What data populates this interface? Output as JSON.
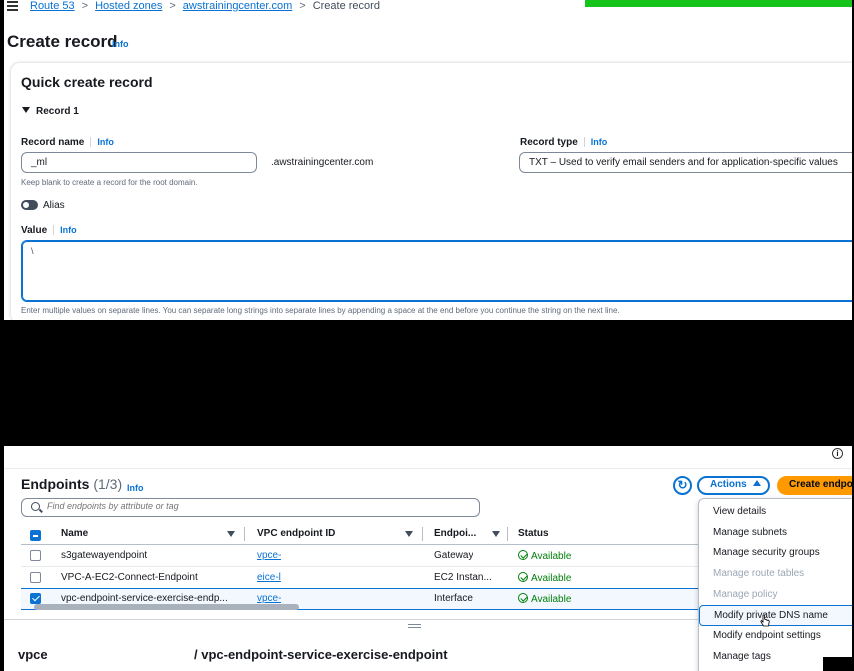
{
  "route53": {
    "breadcrumbs": [
      "Route 53",
      "Hosted zones",
      "awstrainingcenter.com"
    ],
    "breadcrumb_current": "Create record",
    "page_title": "Create record",
    "title_info": "Info",
    "card_title": "Quick create record",
    "record_section": "Record 1",
    "record_name_label": "Record name",
    "record_name_info": "Info",
    "record_name_value": "_ml",
    "domain_suffix": ".awstrainingcenter.com",
    "record_name_hint": "Keep blank to create a record for the root domain.",
    "record_type_label": "Record type",
    "record_type_info": "Info",
    "record_type_value": "TXT – Used to verify email senders and for application-specific values",
    "alias_label": "Alias",
    "value_label": "Value",
    "value_info": "Info",
    "value_text": "\\",
    "value_hint": "Enter multiple values on separate lines. You can separate long strings into separate lines by appending a space at the end before you continue the string on the next line."
  },
  "vpc": {
    "info_icon": "i",
    "title": "Endpoints",
    "count": "(1/3)",
    "title_info": "Info",
    "refresh_icon": "refresh-icon",
    "actions_label": "Actions",
    "create_label": "Create endpoint",
    "search_placeholder": "Find endpoints by attribute or tag",
    "columns": [
      "Name",
      "VPC endpoint ID",
      "Endpoi...",
      "Status"
    ],
    "rows": [
      {
        "name": "s3gatewayendpoint",
        "id": "vpce-",
        "type": "Gateway",
        "status": "Available",
        "selected": false
      },
      {
        "name": "VPC-A-EC2-Connect-Endpoint",
        "id": "eice-l",
        "type": "EC2 Instan...",
        "status": "Available",
        "selected": false
      },
      {
        "name": "vpc-endpoint-service-exercise-endp...",
        "id": "vpce-",
        "type": "Interface",
        "status": "Available",
        "selected": true
      }
    ],
    "detail_prefix": "vpce",
    "detail_title": "/ vpc-endpoint-service-exercise-endpoint",
    "menu": [
      {
        "label": "View details",
        "disabled": false
      },
      {
        "label": "Manage subnets",
        "disabled": false
      },
      {
        "label": "Manage security groups",
        "disabled": false
      },
      {
        "label": "Manage route tables",
        "disabled": true
      },
      {
        "label": "Manage policy",
        "disabled": true
      },
      {
        "label": "Modify private DNS name",
        "disabled": false,
        "hover": true
      },
      {
        "label": "Modify endpoint settings",
        "disabled": false
      },
      {
        "label": "Manage tags",
        "disabled": false
      }
    ]
  },
  "colors": {
    "accent": "#0972d3",
    "primary_button": "#ff9900",
    "available": "#037f0c",
    "banner": "#16c31a"
  }
}
